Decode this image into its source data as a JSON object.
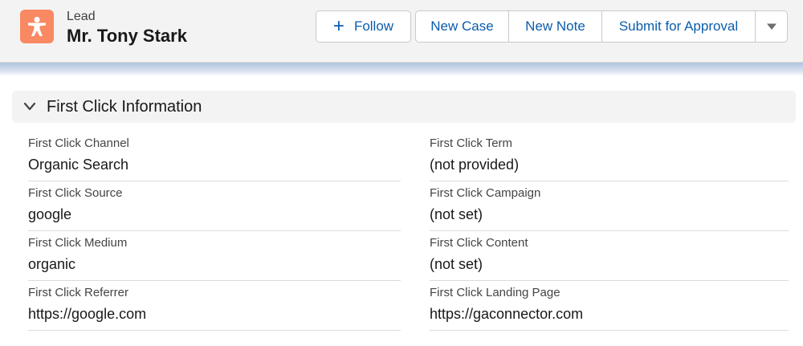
{
  "header": {
    "record_type": "Lead",
    "record_name": "Mr. Tony Stark",
    "icon": "lead-person-icon",
    "icon_color": "#f88962"
  },
  "actions": {
    "follow_label": "Follow",
    "new_case_label": "New Case",
    "new_note_label": "New Note",
    "submit_label": "Submit for Approval",
    "more_icon": "chevron-down-icon"
  },
  "section": {
    "title": "First Click Information",
    "expanded": true
  },
  "fields_left": [
    {
      "label": "First Click Channel",
      "value": "Organic Search"
    },
    {
      "label": "First Click Source",
      "value": "google"
    },
    {
      "label": "First Click Medium",
      "value": "organic"
    },
    {
      "label": "First Click Referrer",
      "value": "https://google.com"
    }
  ],
  "fields_right": [
    {
      "label": "First Click Term",
      "value": "(not provided)"
    },
    {
      "label": "First Click Campaign",
      "value": "(not set)"
    },
    {
      "label": "First Click Content",
      "value": "(not set)"
    },
    {
      "label": "First Click Landing Page",
      "value": "https://gaconnector.com"
    }
  ],
  "colors": {
    "link": "#0b5cab",
    "header_bg": "#f3f3f3"
  }
}
